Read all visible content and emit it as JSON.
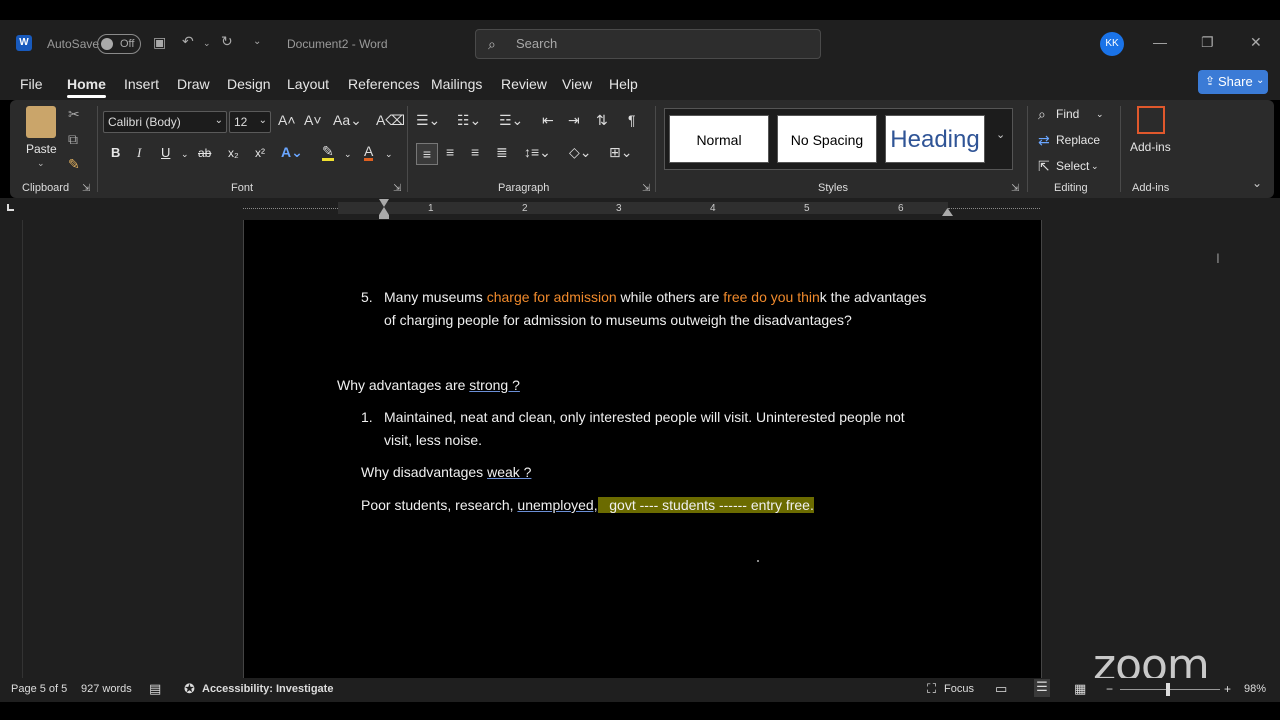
{
  "titlebar": {
    "autosave_label": "AutoSave",
    "autosave_state": "Off",
    "doc_title": "Document2",
    "separator": "-",
    "app_name": "Word",
    "search_placeholder": "Search",
    "user_initials": "KK"
  },
  "tabs": [
    {
      "label": "File"
    },
    {
      "label": "Home"
    },
    {
      "label": "Insert"
    },
    {
      "label": "Draw"
    },
    {
      "label": "Design"
    },
    {
      "label": "Layout"
    },
    {
      "label": "References"
    },
    {
      "label": "Mailings"
    },
    {
      "label": "Review"
    },
    {
      "label": "View"
    },
    {
      "label": "Help"
    }
  ],
  "share_label": "Share",
  "ribbon": {
    "clipboard": {
      "paste_label": "Paste",
      "group_label": "Clipboard"
    },
    "font": {
      "font_name": "Calibri (Body)",
      "font_size": "12",
      "group_label": "Font",
      "bold": "B",
      "italic": "I",
      "underline": "U",
      "strike": "ab",
      "subscript": "x₂",
      "superscript": "x²"
    },
    "paragraph": {
      "group_label": "Paragraph"
    },
    "styles": {
      "group_label": "Styles",
      "items": [
        "Normal",
        "No Spacing",
        "Heading"
      ]
    },
    "editing": {
      "group_label": "Editing",
      "find": "Find",
      "replace": "Replace",
      "select": "Select"
    },
    "addins": {
      "label": "Add-ins",
      "group_label": "Add-ins"
    }
  },
  "ruler": {
    "numbers": [
      "1",
      "2",
      "3",
      "4",
      "5",
      "6"
    ]
  },
  "document": {
    "item5_num": "5.",
    "item5_a": "Many museums ",
    "item5_b": "charge for admission",
    "item5_c": " while others are ",
    "item5_d": "free do you thin",
    "item5_e": "k the advantages",
    "item5_line2": "of charging people for admission to museums outweigh the disadvantages?",
    "q1_a": "Why advantages are ",
    "q1_b": "strong ?",
    "item1_num": "1.",
    "item1_line1": "Maintained, neat and clean, only interested people will visit. Uninterested people not",
    "item1_line2": "visit, less noise.",
    "q2_a": "Why disadvantages ",
    "q2_b": "weak ?",
    "p_a": "Poor students, research, ",
    "p_b": "unemployed,",
    "p_c": "   govt ---- students ------ entry free."
  },
  "status": {
    "page": "Page 5 of 5",
    "words": "927 words",
    "accessibility": "Accessibility: Investigate",
    "focus": "Focus",
    "zoom_level": "98%"
  },
  "watermark": "zoom",
  "colors": {
    "accent": "#3b7bd6",
    "orange_text": "#f08a2c",
    "highlight": "#6b6b00"
  }
}
